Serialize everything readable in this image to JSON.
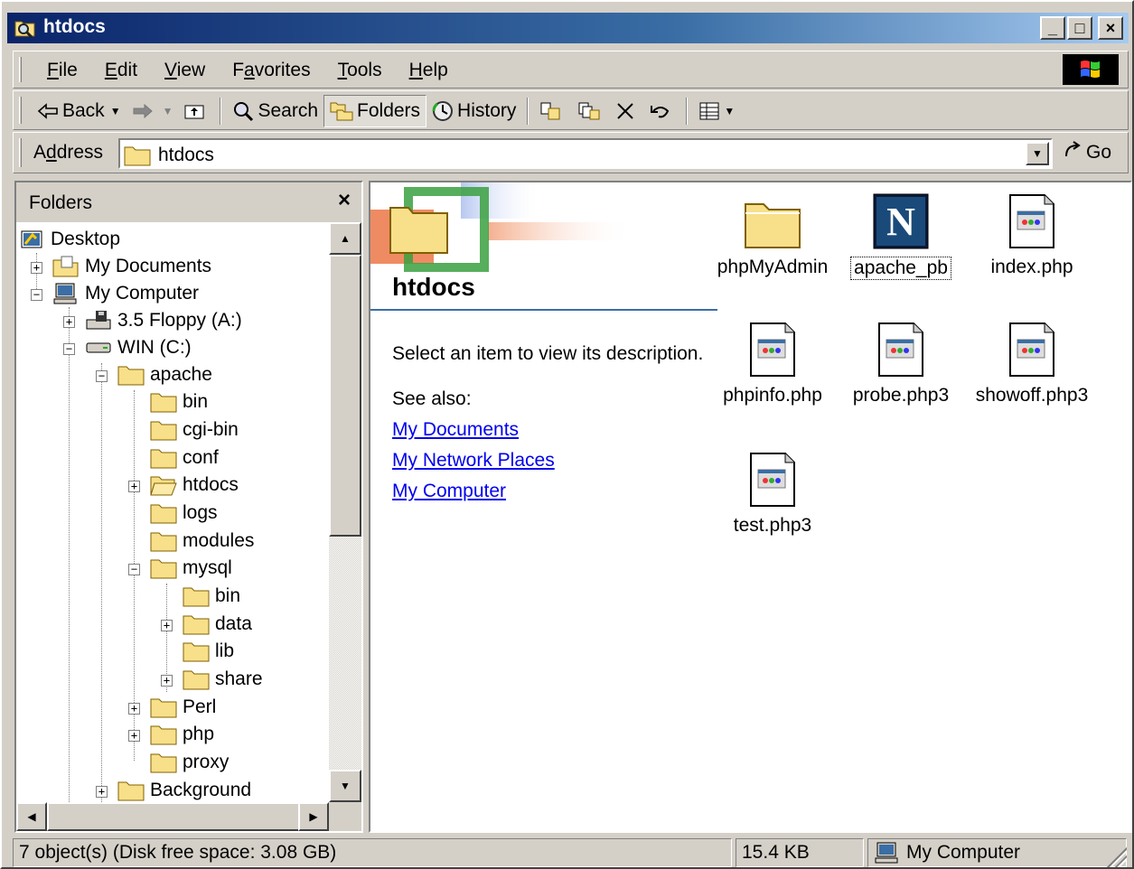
{
  "window": {
    "title": "htdocs",
    "controls": {
      "minimize": "_",
      "maximize": "□",
      "close": "×"
    }
  },
  "menu": [
    {
      "key": "F",
      "rest": "ile"
    },
    {
      "key": "E",
      "rest": "dit"
    },
    {
      "key": "V",
      "rest": "iew"
    },
    {
      "pre": "F",
      "key": "a",
      "rest": "vorites"
    },
    {
      "key": "T",
      "rest": "ools"
    },
    {
      "key": "H",
      "rest": "elp"
    }
  ],
  "toolbar": {
    "back": "Back",
    "search": "Search",
    "folders": "Folders",
    "history": "History"
  },
  "address": {
    "pre": "A",
    "key": "d",
    "rest": "dress",
    "value": "htdocs",
    "go": "Go"
  },
  "folders_pane": {
    "title": "Folders",
    "close": "×",
    "tree": [
      {
        "label": "Desktop"
      },
      {
        "label": "My Documents"
      },
      {
        "label": "My Computer"
      },
      {
        "label": "3.5 Floppy (A:)"
      },
      {
        "label": "WIN (C:)"
      },
      {
        "label": "apache"
      },
      {
        "label": "bin"
      },
      {
        "label": "cgi-bin"
      },
      {
        "label": "conf"
      },
      {
        "label": "htdocs"
      },
      {
        "label": "logs"
      },
      {
        "label": "modules"
      },
      {
        "label": "mysql"
      },
      {
        "label": "bin"
      },
      {
        "label": "data"
      },
      {
        "label": "lib"
      },
      {
        "label": "share"
      },
      {
        "label": "Perl"
      },
      {
        "label": "php"
      },
      {
        "label": "proxy"
      },
      {
        "label": "Background"
      }
    ]
  },
  "content": {
    "heading": "htdocs",
    "description": "Select an item to view its description.",
    "see_also": "See also:",
    "links": [
      "My Documents",
      "My Network Places",
      "My Computer"
    ],
    "files": [
      {
        "name": "phpMyAdmin",
        "icon": "folder-icon"
      },
      {
        "name": "apache_pb",
        "icon": "netscape-icon"
      },
      {
        "name": "index.php",
        "icon": "php-file-icon"
      },
      {
        "name": "phpinfo.php",
        "icon": "php-file-icon"
      },
      {
        "name": "probe.php3",
        "icon": "php-file-icon"
      },
      {
        "name": "showoff.php3",
        "icon": "php-file-icon"
      },
      {
        "name": "test.php3",
        "icon": "php-file-icon"
      }
    ]
  },
  "status": {
    "objects": "7 object(s) (Disk free space: 3.08 GB)",
    "size": "15.4 KB",
    "zone": "My Computer"
  }
}
